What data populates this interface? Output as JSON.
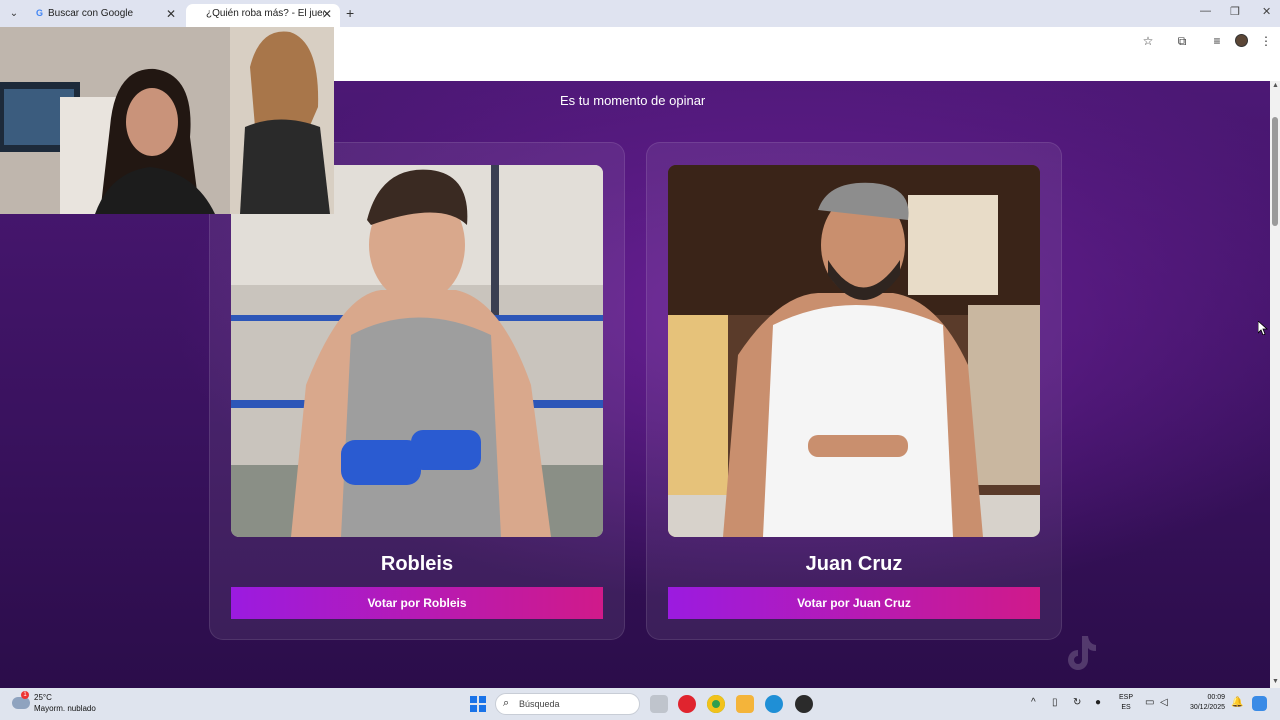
{
  "browser": {
    "tabs": [
      {
        "title": "Buscar con Google",
        "favicon": "google-icon"
      },
      {
        "title": "¿Quién roba más? - El juego qu",
        "favicon": "page-icon"
      }
    ]
  },
  "page": {
    "subtitle": "Es tu momento de opinar",
    "candidates": [
      {
        "name": "Robleis",
        "vote_label": "Votar por Robleis"
      },
      {
        "name": "Juan Cruz",
        "vote_label": "Votar por Juan Cruz"
      }
    ],
    "colors": {
      "bg_top": "#4c1875",
      "button_start": "#9b1be0",
      "button_end": "#d01a8a"
    }
  },
  "taskbar": {
    "weather": {
      "temp": "25°C",
      "condition": "Mayorm. nublado",
      "badge": "1"
    },
    "search_placeholder": "Búsqueda",
    "language": {
      "line1": "ESP",
      "line2": "ES"
    },
    "clock": {
      "time": "00:09",
      "date": "30/12/2025"
    }
  }
}
